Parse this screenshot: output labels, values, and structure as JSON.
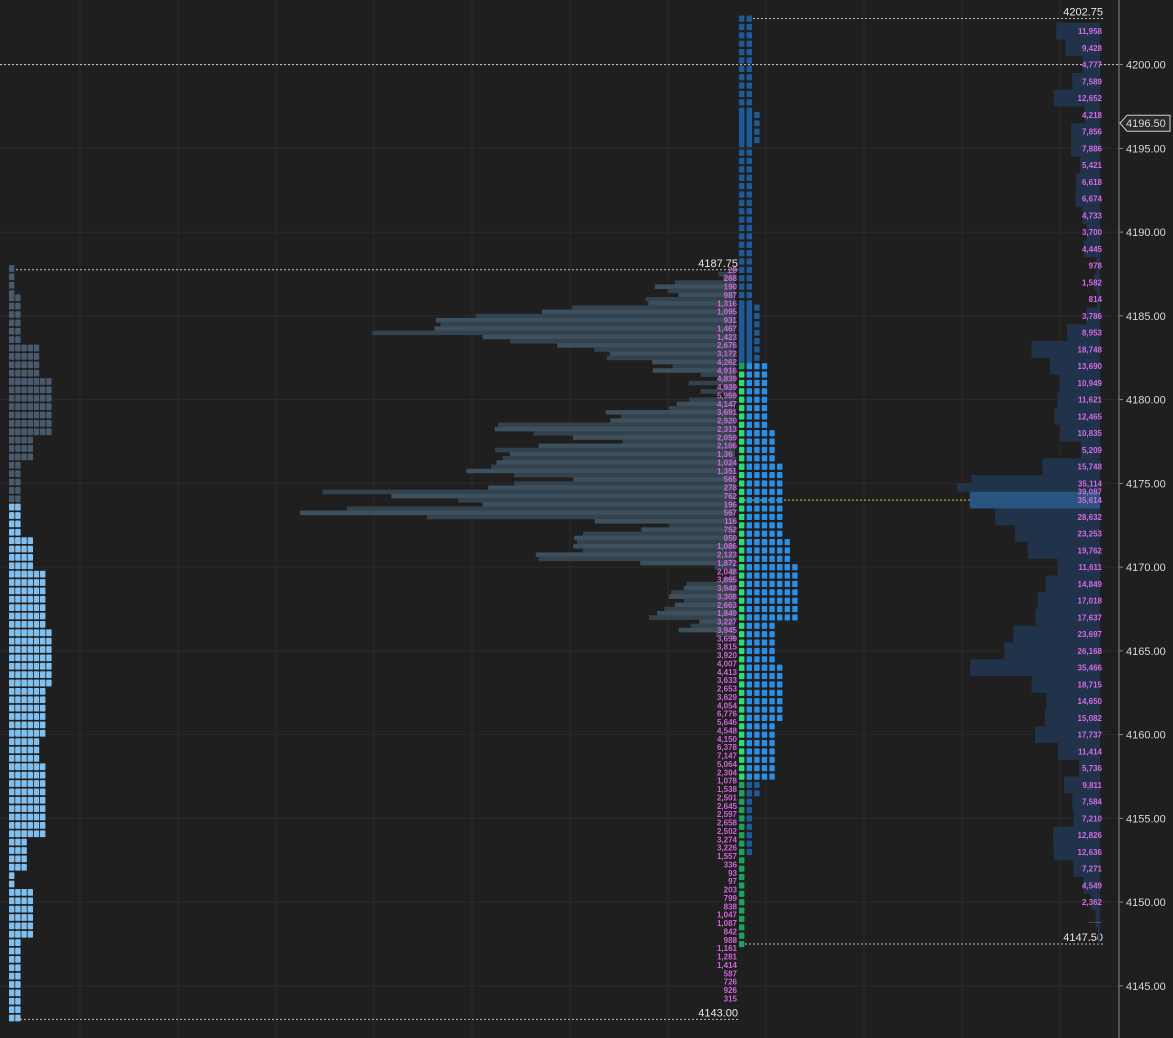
{
  "colors": {
    "background": "#1f1f1f",
    "grid": "#2b2b2b",
    "axis_line": "#8a8a8a",
    "left_tpo_dark": "#485a6c",
    "left_tpo_light": "#7fc0f0",
    "poc_yellow": "#f0c419",
    "center_single": "#1e5a9a",
    "center_block": "#2b8fe6",
    "center_green": "#28e07a",
    "center_green_dark": "#1aa35e",
    "vol_profile": "#33424d",
    "vol_profile_light": "#3d505d",
    "vol_poc": "#52707f",
    "right_profile": "#20334a",
    "right_profile_poc": "#2a5580",
    "vol_text": "#d56adf",
    "last_price_box": "#d0d0d0"
  },
  "axis": {
    "ticks": [
      {
        "value": 4200,
        "label": "4200.00"
      },
      {
        "value": 4195,
        "label": "4195.00"
      },
      {
        "value": 4190,
        "label": "4190.00"
      },
      {
        "value": 4185,
        "label": "4185.00"
      },
      {
        "value": 4180,
        "label": "4180.00"
      },
      {
        "value": 4175,
        "label": "4175.00"
      },
      {
        "value": 4170,
        "label": "4170.00"
      },
      {
        "value": 4165,
        "label": "4165.00"
      },
      {
        "value": 4160,
        "label": "4160.00"
      },
      {
        "value": 4155,
        "label": "4155.00"
      },
      {
        "value": 4150,
        "label": "4150.00"
      },
      {
        "value": 4145,
        "label": "4145.00"
      }
    ],
    "last_price": "4196.50"
  },
  "chart_data": {
    "type": "bar",
    "price_range": [
      4142.5,
      4204.25
    ],
    "tick_size": 0.25,
    "reference_lines": [
      {
        "price": 4200.0,
        "style": "dotted"
      },
      {
        "price": 4174.0,
        "style": "dotted-yellow"
      }
    ],
    "extremes": [
      {
        "label": "4202.75",
        "price": 4202.75
      },
      {
        "label": "4187.75",
        "price": 4187.75
      },
      {
        "label": "4147.50",
        "price": 4147.5
      },
      {
        "label": "4143.00",
        "price": 4143.0
      }
    ],
    "left_profile": {
      "high": 4187.75,
      "low": 4143.0,
      "split_price": 4173.5,
      "poc_price": 4165.75,
      "poc_blocks": 9,
      "blocks": [
        {
          "from": 4187.75,
          "to": 4186.0,
          "n": 1
        },
        {
          "from": 4186.0,
          "to": 4183.0,
          "n": 2
        },
        {
          "from": 4183.0,
          "to": 4181.0,
          "n": 5
        },
        {
          "from": 4181.0,
          "to": 4178.0,
          "n": 7
        },
        {
          "from": 4178.0,
          "to": 4176.5,
          "n": 4
        },
        {
          "from": 4176.5,
          "to": 4173.5,
          "n": 2
        },
        {
          "from": 4173.5,
          "to": 4171.5,
          "n": 2
        },
        {
          "from": 4171.5,
          "to": 4169.5,
          "n": 4
        },
        {
          "from": 4169.5,
          "to": 4166.0,
          "n": 6
        },
        {
          "from": 4166.0,
          "to": 4163.0,
          "n": 7
        },
        {
          "from": 4163.0,
          "to": 4160.0,
          "n": 6
        },
        {
          "from": 4160.0,
          "to": 4158.0,
          "n": 5
        },
        {
          "from": 4158.0,
          "to": 4154.0,
          "n": 6
        },
        {
          "from": 4154.0,
          "to": 4152.0,
          "n": 3
        },
        {
          "from": 4152.0,
          "to": 4150.5,
          "n": 1
        },
        {
          "from": 4150.5,
          "to": 4148.0,
          "n": 4
        },
        {
          "from": 4148.0,
          "to": 4143.0,
          "n": 2
        }
      ]
    },
    "center_profile": {
      "high": 4202.75,
      "low": 4147.5,
      "poc_price": 4176.75,
      "poc_blocks": 8,
      "green_from": 4181.5,
      "green_to": 4147.5,
      "columns": [
        {
          "from": 4202.75,
          "to": 4182.0,
          "n": 2
        },
        {
          "from": 4197.0,
          "to": 4195.0,
          "n": 3
        },
        {
          "from": 4185.5,
          "to": 4182.0,
          "n": 3
        }
      ],
      "blocks": [
        {
          "from": 4182.0,
          "to": 4178.0,
          "n": 4
        },
        {
          "from": 4178.0,
          "to": 4176.0,
          "n": 5
        },
        {
          "from": 4176.0,
          "to": 4171.5,
          "n": 6
        },
        {
          "from": 4171.5,
          "to": 4170.0,
          "n": 7
        },
        {
          "from": 4170.0,
          "to": 4167.0,
          "n": 8
        },
        {
          "from": 4167.0,
          "to": 4164.0,
          "n": 5
        },
        {
          "from": 4164.0,
          "to": 4161.0,
          "n": 6
        },
        {
          "from": 4161.0,
          "to": 4157.5,
          "n": 5
        },
        {
          "from": 4157.5,
          "to": 4156.5,
          "n": 3
        },
        {
          "from": 4156.5,
          "to": 4153.0,
          "n": 2
        },
        {
          "from": 4153.0,
          "to": 4147.5,
          "n": 1
        }
      ]
    },
    "session_volume": {
      "prices": [
        4187.75,
        4187.5,
        4187.25,
        4187.0,
        4186.75,
        4186.5,
        4186.25,
        4186.0,
        4185.75,
        4185.5,
        4185.25,
        4185.0,
        4184.75,
        4184.5,
        4184.25,
        4184.0,
        4183.75,
        4183.5,
        4183.25,
        4183.0,
        4182.75,
        4182.5,
        4182.25,
        4182.0,
        4181.75,
        4181.5,
        4181.25,
        4181.0,
        4180.75,
        4180.5,
        4180.25,
        4180.0,
        4179.75,
        4179.5,
        4179.25,
        4179.0,
        4178.75,
        4178.5,
        4178.25,
        4178.0,
        4177.75,
        4177.5,
        4177.25,
        4177.0,
        4176.75,
        4176.5,
        4176.25,
        4176.0,
        4175.75,
        4175.5,
        4175.25,
        4175.0,
        4174.75,
        4174.5,
        4174.25,
        4174.0,
        4173.75,
        4173.5,
        4173.25,
        4173.0,
        4172.75,
        4172.5,
        4172.25,
        4172.0,
        4171.75,
        4171.5,
        4171.25,
        4171.0,
        4170.75,
        4170.5,
        4170.25,
        4170.0,
        4169.75,
        4169.5,
        4169.25,
        4169.0,
        4168.75,
        4168.5,
        4168.25,
        4168.0,
        4167.75,
        4167.5,
        4167.25,
        4167.0,
        4166.75,
        4166.5,
        4166.25,
        4166.0,
        4165.75,
        4165.5,
        4165.25,
        4165.0,
        4164.75,
        4164.5,
        4164.25,
        4164.0,
        4163.75,
        4163.5,
        4163.25,
        4163.0,
        4162.75,
        4162.5,
        4162.25,
        4162.0,
        4161.75,
        4161.5,
        4161.25,
        4161.0,
        4160.75,
        4160.5,
        4160.25,
        4160.0,
        4159.75,
        4159.5,
        4159.25,
        4159.0,
        4158.75,
        4158.5,
        4158.25,
        4158.0,
        4157.75,
        4157.5,
        4157.25,
        4157.0,
        4156.75,
        4156.5,
        4156.25,
        4156.0,
        4155.75,
        4155.5,
        4155.25,
        4155.0,
        4154.75,
        4154.5,
        4154.25,
        4154.0,
        4153.75,
        4153.5,
        4153.25,
        4153.0,
        4152.75,
        4152.5,
        4152.25,
        4152.0,
        4151.75,
        4151.5,
        4151.25,
        4151.0,
        4150.75,
        4150.5,
        4150.25,
        4150.0,
        4149.75,
        4149.5,
        4149.25,
        4149.0,
        4148.75,
        4148.5,
        4148.25,
        4148.0,
        4147.75,
        4147.5,
        4147.25,
        4147.0,
        4146.75,
        4146.5,
        4146.25,
        4146.0,
        4145.75,
        4145.5,
        4145.25,
        4145.0,
        4144.75,
        4144.5,
        4144.25,
        4144.0,
        4143.75,
        4143.5,
        4143.25,
        4143.0
      ],
      "labels": [
        "28",
        "268",
        "190",
        "987",
        "1,316",
        "1,095",
        "931",
        "1,467",
        "1,423",
        "2,676",
        "3,172",
        "4,262",
        "4,916",
        "4,839",
        "4,939",
        "5,959",
        "4,147",
        "3,691",
        "2,920",
        "2,313",
        "2,059",
        "2,106",
        "1,36_",
        "1,024",
        "1,351",
        "565",
        "278",
        "762",
        "196",
        "567",
        "116",
        "752",
        "959",
        "1,086",
        "2,123",
        "1,872",
        "2,048",
        "3,895",
        "3,948",
        "3,308",
        "2,663",
        "1,849",
        "3,227",
        "3,945",
        "3,699",
        "3,815",
        "3,920",
        "4,007",
        "4,413",
        "3,633",
        "2,653",
        "3,629",
        "4,054",
        "6,776",
        "5,646",
        "4,548",
        "4,150",
        "6,378",
        "7,147",
        "5,064",
        "2,304",
        "1,078",
        "1,538",
        "2,501",
        "2,645",
        "2,597",
        "2,658",
        "2,502",
        "3,274",
        "3,226",
        "1,557",
        "336",
        "93",
        "97",
        "203",
        "799",
        "838",
        "1,047",
        "1,087",
        "842",
        "988",
        "1,161",
        "1,281",
        "1,414",
        "587",
        "726",
        "926",
        "315",
        "___"
      ],
      "values": [
        28,
        268,
        190,
        987,
        1316,
        1095,
        931,
        1467,
        1423,
        2676,
        3172,
        4262,
        4916,
        4839,
        4939,
        5959,
        4147,
        3691,
        2920,
        2313,
        2059,
        2106,
        1360,
        1024,
        1351,
        565,
        278,
        762,
        196,
        567,
        116,
        752,
        959,
        1086,
        2123,
        1872,
        2048,
        3895,
        3948,
        3308,
        2663,
        1849,
        3227,
        3945,
        3699,
        3815,
        3920,
        4007,
        4413,
        3633,
        2653,
        3629,
        4054,
        6776,
        5646,
        4548,
        4150,
        6378,
        7147,
        5064,
        2304,
        1078,
        1538,
        2501,
        2645,
        2597,
        2658,
        2502,
        3274,
        3226,
        1557,
        336,
        93,
        97,
        203,
        799,
        838,
        1047,
        1087,
        842,
        988,
        1161,
        1281,
        1414,
        587,
        726,
        926,
        315,
        50
      ],
      "poc_price": 4158.5
    },
    "total_volume": {
      "prices": [
        4202.0,
        4201.0,
        4200.0,
        4199.0,
        4198.0,
        4197.0,
        4196.0,
        4195.0,
        4194.0,
        4193.0,
        4192.0,
        4191.0,
        4190.0,
        4189.0,
        4188.0,
        4187.0,
        4186.0,
        4185.0,
        4184.0,
        4183.0,
        4182.0,
        4181.0,
        4180.0,
        4179.0,
        4178.0,
        4177.0,
        4176.0,
        4175.0,
        4174.5,
        4174.0,
        4173.0,
        4172.0,
        4171.0,
        4170.0,
        4169.0,
        4168.0,
        4167.0,
        4166.0,
        4165.0,
        4164.0,
        4163.0,
        4162.0,
        4161.0,
        4160.0,
        4159.0,
        4158.0,
        4157.0,
        4156.0,
        4155.0,
        4154.0,
        4153.0,
        4152.0,
        4151.0,
        4150.0,
        4149.0,
        4148.0
      ],
      "labels": [
        "11,958",
        "9,428",
        "4,777",
        "7,589",
        "12,652",
        "4,218",
        "7,856",
        "7,886",
        "5,421",
        "6,618",
        "6,674",
        "4,733",
        "3,700",
        "4,445",
        "978",
        "1,582",
        "814",
        "3,786",
        "8,953",
        "18,748",
        "13,690",
        "10,949",
        "11,621",
        "12,465",
        "10,835",
        "5,209",
        "15,748",
        "35,114",
        "39,087",
        "35,614",
        "28,632",
        "23,253",
        "19,762",
        "11,611",
        "14,849",
        "17,018",
        "17,637",
        "23,697",
        "26,168",
        "35,466",
        "18,715",
        "14,650",
        "15,082",
        "17,737",
        "11,414",
        "5,736",
        "9,811",
        "7,584",
        "7,210",
        "12,826",
        "12,636",
        "7,271",
        "4,549",
        "2,362",
        "___",
        "___"
      ],
      "values": [
        11958,
        9428,
        4777,
        7589,
        12652,
        4218,
        7856,
        7886,
        5421,
        6618,
        6674,
        4733,
        3700,
        4445,
        978,
        1582,
        814,
        3786,
        8953,
        18748,
        13690,
        10949,
        11621,
        12465,
        10835,
        5209,
        15748,
        35114,
        39087,
        35614,
        28632,
        23253,
        19762,
        11611,
        14849,
        17018,
        17637,
        23697,
        26168,
        35466,
        18715,
        14650,
        15082,
        17737,
        11414,
        5736,
        9811,
        7584,
        7210,
        12826,
        12636,
        7271,
        4549,
        2362,
        1200,
        600
      ],
      "poc_price": 4174.0
    }
  }
}
